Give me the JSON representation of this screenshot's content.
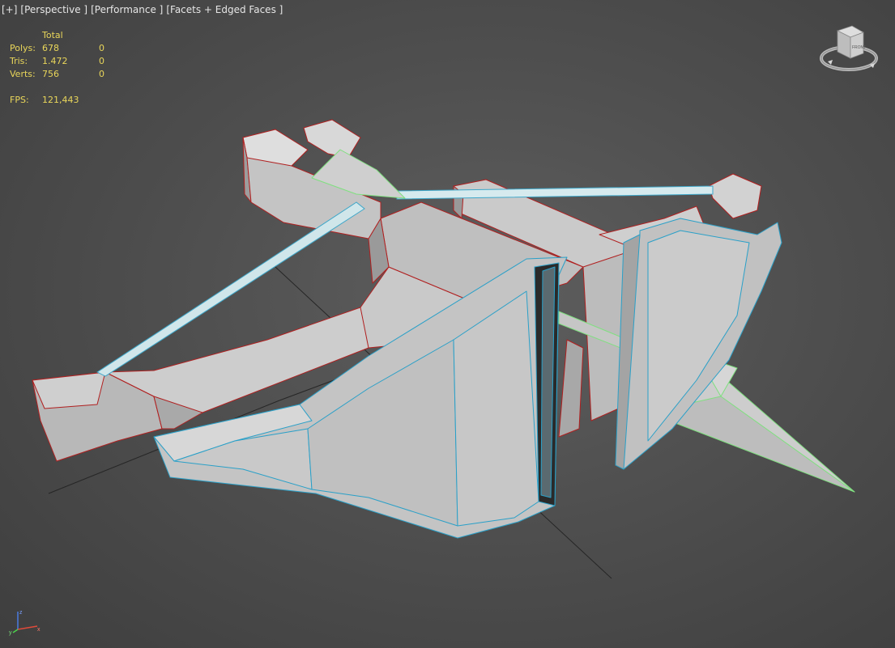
{
  "viewport": {
    "labels": {
      "plus": "[+]",
      "view": "[Perspective ]",
      "mode": "[Performance ]",
      "shading": "[Facets + Edged Faces ]"
    }
  },
  "stats": {
    "header": "Total",
    "rows": [
      {
        "label": "Polys:",
        "total": "678",
        "selected": "0"
      },
      {
        "label": "Tris:",
        "total": "1.472",
        "selected": "0"
      },
      {
        "label": "Verts:",
        "total": "756",
        "selected": "0"
      }
    ],
    "fps_label": "FPS:",
    "fps_value": "121,443"
  },
  "viewcube": {
    "face_label": "FRONT",
    "icon": "viewcube-icon"
  },
  "axis": {
    "x": "x",
    "y": "y",
    "z": "z",
    "colors": {
      "x": "#e04a3a",
      "y": "#4bd24b",
      "z": "#4a7ae0"
    }
  },
  "colors": {
    "background": "#4f4f4f",
    "grid": "#1a1a1a",
    "mesh_fill": "#c8c8c8",
    "mesh_edge_red": "#b02020",
    "mesh_edge_blue": "#2aa0c8",
    "mesh_edge_green": "#7fe07f",
    "stats_text": "#e9d65a"
  }
}
